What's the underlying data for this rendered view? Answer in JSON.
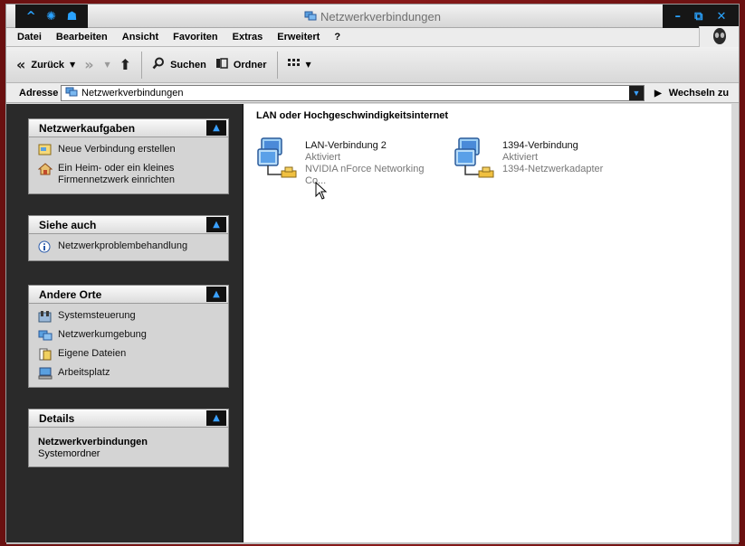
{
  "window": {
    "title": "Netzwerkverbindungen",
    "left_controls": [
      "caret-up-icon",
      "gear-icon",
      "alien-icon"
    ],
    "right_controls": [
      "minimize-icon",
      "restore-icon",
      "close-icon"
    ]
  },
  "menu": [
    "Datei",
    "Bearbeiten",
    "Ansicht",
    "Favoriten",
    "Extras",
    "Erweitert",
    "?"
  ],
  "toolbar": {
    "back_label": "Zurück",
    "search_label": "Suchen",
    "folders_label": "Ordner"
  },
  "address": {
    "label": "Adresse",
    "value": "Netzwerkverbindungen",
    "go_label": "Wechseln zu"
  },
  "panels": {
    "network_tasks": {
      "title": "Netzwerkaufgaben",
      "items": [
        "Neue Verbindung erstellen",
        "Ein Heim- oder ein kleines Firmennetzwerk einrichten"
      ]
    },
    "see_also": {
      "title": "Siehe auch",
      "items": [
        "Netzwerkproblembehandlung"
      ]
    },
    "other_places": {
      "title": "Andere Orte",
      "items": [
        "Systemsteuerung",
        "Netzwerkumgebung",
        "Eigene Dateien",
        "Arbeitsplatz"
      ]
    },
    "details": {
      "title": "Details",
      "name": "Netzwerkverbindungen",
      "type": "Systemordner"
    }
  },
  "content": {
    "group_title": "LAN oder Hochgeschwindigkeitsinternet",
    "connections": [
      {
        "name": "LAN-Verbindung 2",
        "status": "Aktiviert",
        "device": "NVIDIA nForce Networking Co..."
      },
      {
        "name": "1394-Verbindung",
        "status": "Aktiviert",
        "device": "1394-Netzwerkadapter"
      }
    ]
  },
  "colors": {
    "accent": "#2aa3ff",
    "sidebar_bg": "#2a2a2a",
    "panel_bg": "#d4d4d4",
    "frame_red": "#8a1a1a"
  }
}
